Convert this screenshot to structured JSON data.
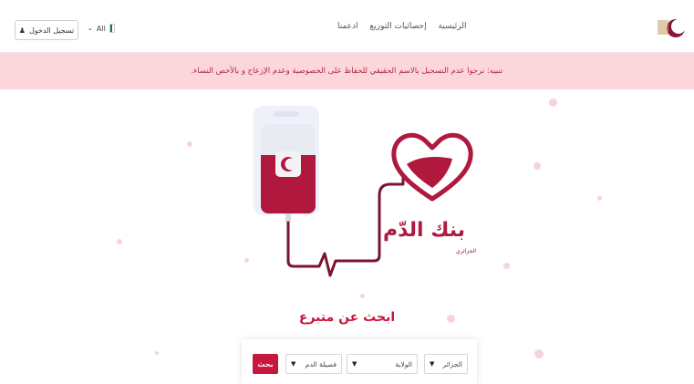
{
  "nav": {
    "links": [
      "الرئيسية",
      "إحصائيات التوزيع",
      "ادعمنا"
    ],
    "login_label": "تسجيل الدخول",
    "language_label": "All"
  },
  "banner": {
    "text": "تنبيه: نرجوا عدم التسجيل بالاسم الحقيقي للحفاظ على الخصوصية وعدم الإزعاج و بالأخص النساء."
  },
  "hero": {
    "brand_title": "بنك الدّم",
    "brand_subtitle": "الجزائري"
  },
  "search": {
    "title": "ابحث عن متبرع",
    "country_select": "الجزائر",
    "wilaya_select": "الولاية",
    "blood_type_select": "فصيلة الدم",
    "button_label": "بحث"
  },
  "colors": {
    "brand": "#c8163c",
    "banner_bg": "#fbd7dc",
    "outline": "#7a1430"
  },
  "icons": [
    "logo-icon",
    "user-icon",
    "flag-icon",
    "chevron-down-icon",
    "heart-icon",
    "blood-bag-icon",
    "crescent-icon"
  ]
}
